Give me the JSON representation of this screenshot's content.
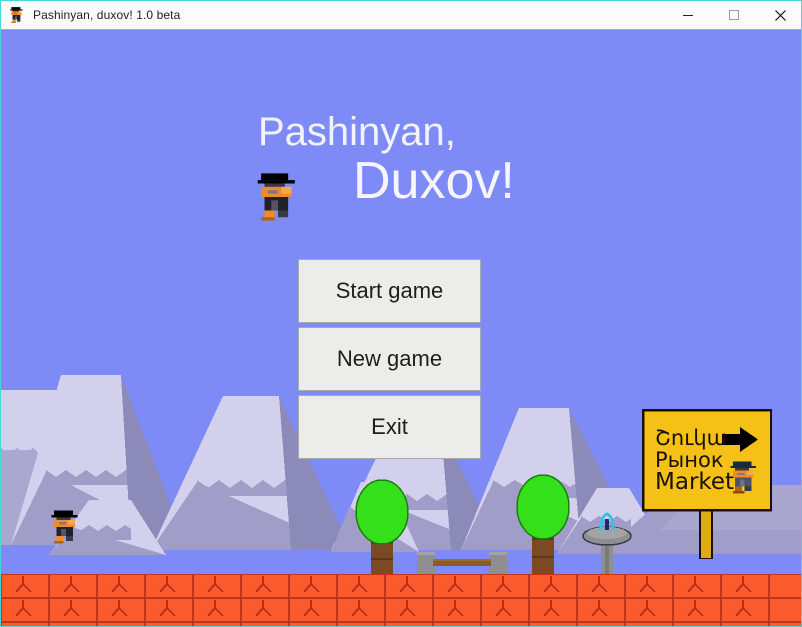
{
  "window": {
    "title": "Pashinyan, duxov! 1.0 beta",
    "icon": "pashinyan-character-icon",
    "border_color": "#4ad6d6",
    "controls": [
      {
        "name": "minimize-button",
        "glyph": "minimize-icon",
        "label": "Minimize"
      },
      {
        "name": "maximize-button",
        "glyph": "maximize-icon",
        "label": "Maximize"
      },
      {
        "name": "close-button",
        "glyph": "close-icon",
        "label": "Close"
      }
    ]
  },
  "game": {
    "title_line1": "Pashinyan,",
    "title_line2": "Duxov!",
    "title_sprite": "pashinyan-character-sprite",
    "menu": [
      {
        "id": "start-game",
        "label": "Start game"
      },
      {
        "id": "new-game",
        "label": "New game"
      },
      {
        "id": "exit",
        "label": "Exit"
      }
    ]
  },
  "sign": {
    "line_armenian": "Շուկա",
    "line_russian": "Рынок",
    "line_english": "Market",
    "arrow": "arrow-right-icon",
    "sprite": "pashinyan-character-sprite",
    "board_color": "#f5c117",
    "post_color": "#e0aa12"
  },
  "scenery": {
    "sky_color": "#7e8bf7",
    "mountain_snow_color": "#d2d0ec",
    "mountain_body_color": "#a09dc9",
    "mountain_shadow_color": "#8c8ab8",
    "ground_brick_color": "#fb5a2d",
    "ground_mortar_color": "#c2331b",
    "tree_leaf_color": "#33e019",
    "tree_trunk_color": "#7c4a22",
    "bench_wood_color": "#8a5a2b",
    "bench_stone_color": "#8f8f93",
    "fountain_color": "#8f8f93",
    "fountain_water_color": "#2ec7e8",
    "ground_character": "pashinyan-character-sprite",
    "objects": [
      {
        "name": "mountain-range",
        "count": 7
      },
      {
        "name": "tree",
        "count": 2
      },
      {
        "name": "bench",
        "count": 1
      },
      {
        "name": "fountain",
        "count": 1
      },
      {
        "name": "brick-ground",
        "count": 1
      }
    ]
  }
}
